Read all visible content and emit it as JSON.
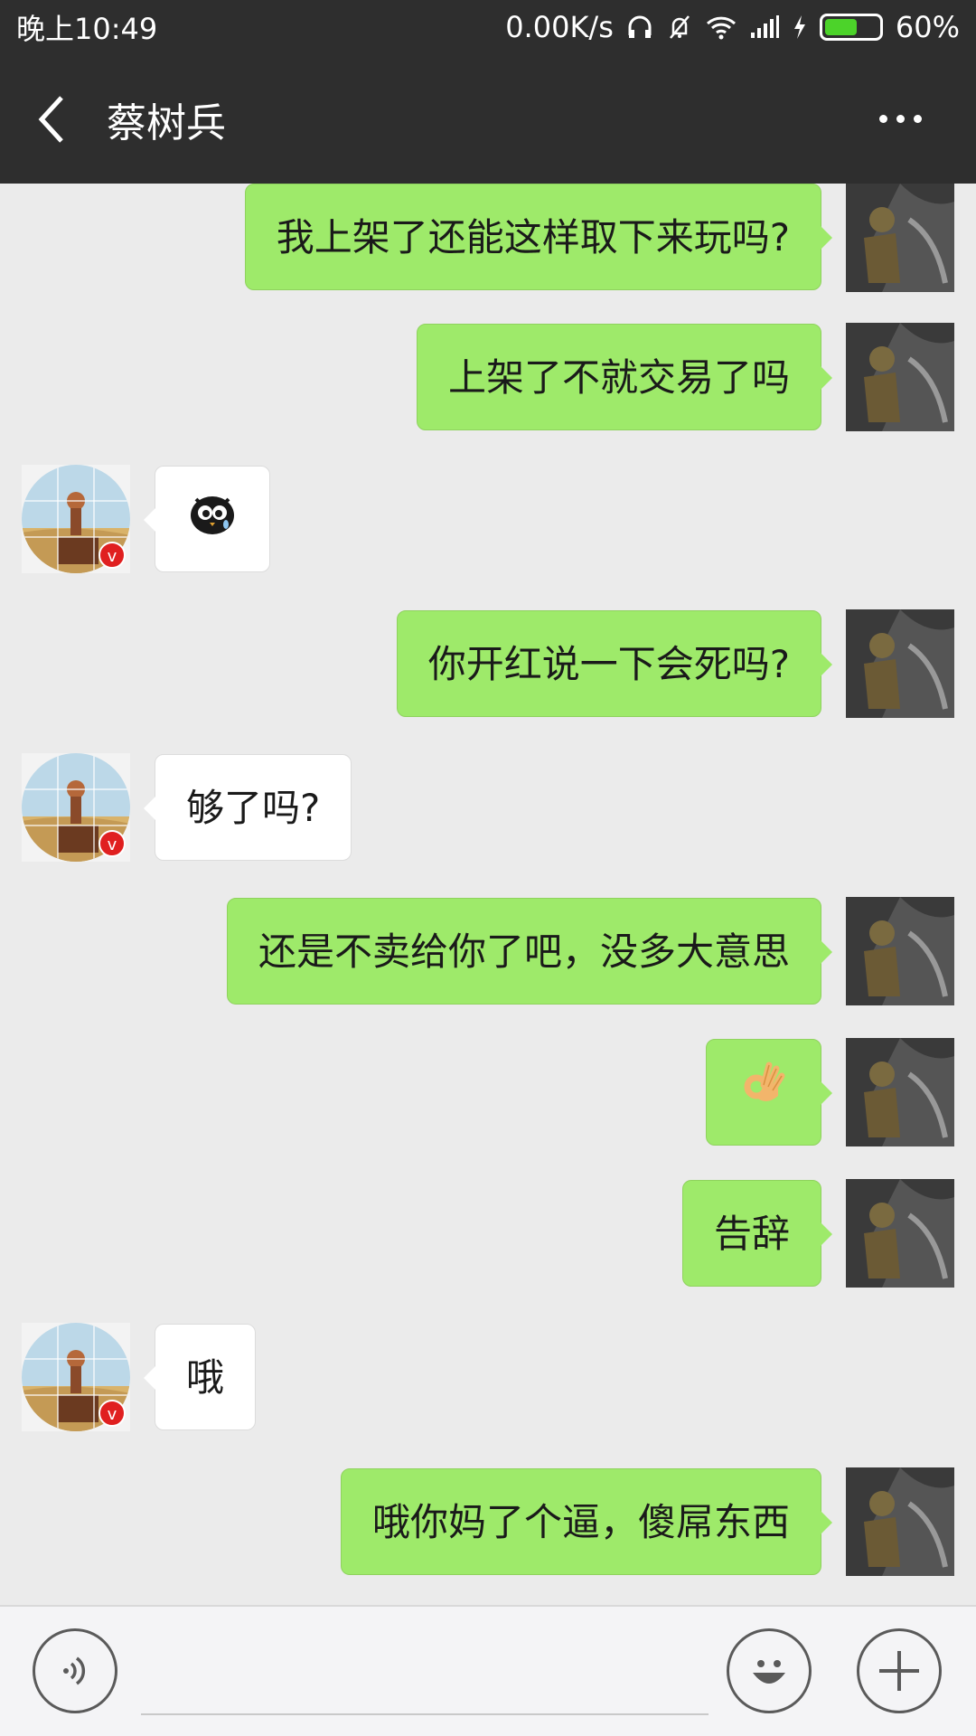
{
  "status_bar": {
    "time": "晚上10:49",
    "network_speed": "0.00K/s",
    "battery_percent": "60%",
    "battery_level": 0.6
  },
  "header": {
    "title": "蔡树兵",
    "back_icon": "chevron-left-icon",
    "more_icon": "more-dots-icon"
  },
  "messages": [
    {
      "from": "me",
      "text": "我上架了还能这样取下来玩吗?"
    },
    {
      "from": "me",
      "text": "上架了不就交易了吗"
    },
    {
      "from": "them",
      "sticker": "owl-emoji"
    },
    {
      "from": "me",
      "text": "你开红说一下会死吗?"
    },
    {
      "from": "them",
      "text": "够了吗?"
    },
    {
      "from": "me",
      "text": "还是不卖给你了吧，没多大意思"
    },
    {
      "from": "me",
      "sticker": "ok-hand-emoji"
    },
    {
      "from": "me",
      "text": "告辞"
    },
    {
      "from": "them",
      "text": "哦"
    },
    {
      "from": "me",
      "text": "哦你妈了个逼，傻屌东西"
    }
  ],
  "input_bar": {
    "voice_icon": "voice-icon",
    "emoji_icon": "emoji-icon",
    "add_icon": "plus-icon",
    "placeholder": ""
  },
  "colors": {
    "header_bg": "#2e2e2e",
    "chat_bg": "#ebebeb",
    "my_bubble": "#9eea6a",
    "their_bubble": "#ffffff"
  }
}
